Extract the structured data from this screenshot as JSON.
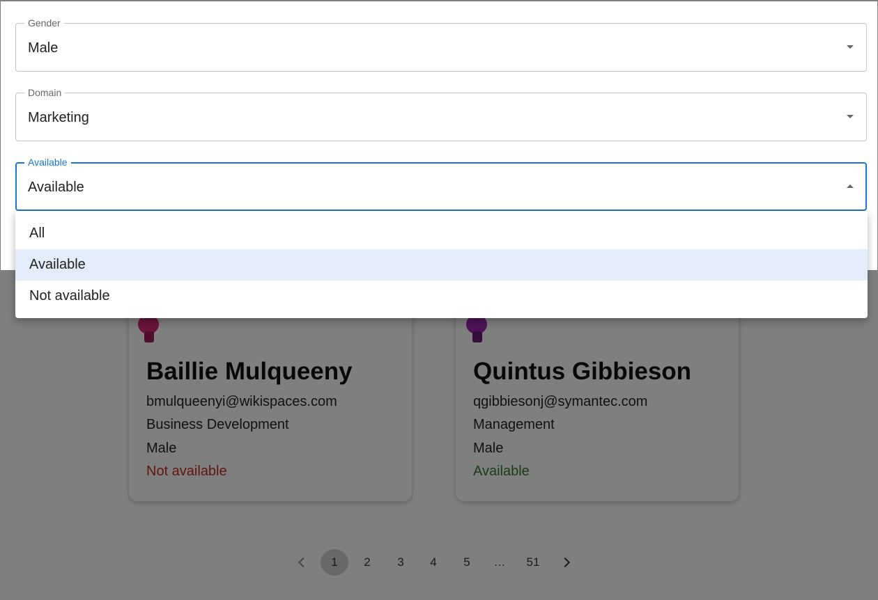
{
  "filters": {
    "gender": {
      "label": "Gender",
      "value": "Male"
    },
    "domain": {
      "label": "Domain",
      "value": "Marketing"
    },
    "available": {
      "label": "Available",
      "value": "Available"
    }
  },
  "menu": {
    "options": [
      "All",
      "Available",
      "Not available"
    ],
    "selected": "Available"
  },
  "cards": [
    {
      "name": "Baillie Mulqueeny",
      "email": "bmulqueenyi@wikispaces.com",
      "domain": "Business Development",
      "gender": "Male",
      "status": "Not available",
      "status_color": "#c62828",
      "avatar_color": "#d6287a"
    },
    {
      "name": "Quintus Gibbieson",
      "email": "qgibbiesonj@symantec.com",
      "domain": "Management",
      "gender": "Male",
      "status": "Available",
      "status_color": "#2e7d32",
      "avatar_color": "#9c27b0"
    }
  ],
  "pagination": {
    "pages": [
      "1",
      "2",
      "3",
      "4",
      "5",
      "…",
      "51"
    ],
    "current": "1",
    "prev_icon": "chevron-left-icon",
    "next_icon": "chevron-right-icon"
  },
  "colors": {
    "accent": "#1976d2",
    "selected_option_bg": "#e3ecf8"
  }
}
